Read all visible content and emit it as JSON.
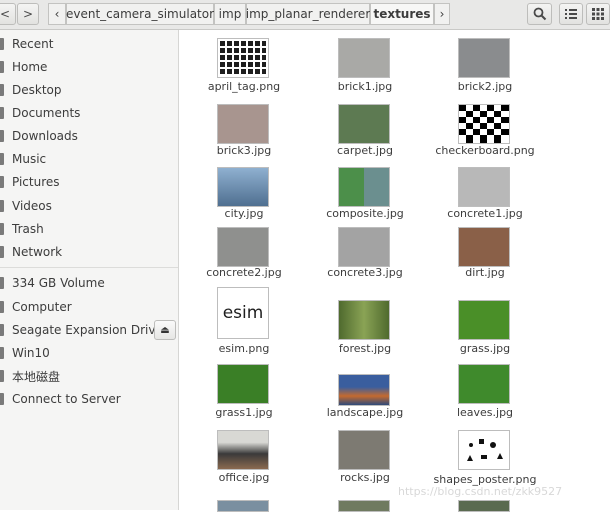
{
  "header": {
    "back_glyph": "<",
    "forward_glyph": ">",
    "crumb_left_glyph": "‹",
    "crumb_right_glyph": "›",
    "breadcrumbs": [
      "event_camera_simulator",
      "imp",
      "imp_planar_renderer",
      "textures"
    ],
    "search_icon": "search-icon",
    "list_icon": "list-view-icon",
    "grid_icon": "grid-view-icon"
  },
  "sidebar": {
    "items": [
      {
        "label": "Recent",
        "icon": "clock-icon"
      },
      {
        "label": "Home",
        "icon": "home-icon"
      },
      {
        "label": "Desktop",
        "icon": "desktop-icon"
      },
      {
        "label": "Documents",
        "icon": "documents-icon"
      },
      {
        "label": "Downloads",
        "icon": "downloads-icon"
      },
      {
        "label": "Music",
        "icon": "music-icon"
      },
      {
        "label": "Pictures",
        "icon": "pictures-icon"
      },
      {
        "label": "Videos",
        "icon": "videos-icon"
      },
      {
        "label": "Trash",
        "icon": "trash-icon"
      },
      {
        "label": "Network",
        "icon": "network-icon"
      },
      {
        "label": "334 GB Volume",
        "icon": "drive-icon"
      },
      {
        "label": "Computer",
        "icon": "computer-icon"
      },
      {
        "label": "Seagate Expansion Drive",
        "icon": "drive-icon"
      },
      {
        "label": "Win10",
        "icon": "drive-icon"
      },
      {
        "label": "本地磁盘",
        "icon": "drive-icon"
      },
      {
        "label": "Connect to Server",
        "icon": "server-icon"
      }
    ],
    "eject_glyph": "⏏"
  },
  "files": [
    {
      "name": "april_tag.png",
      "color": "#1e1e1e"
    },
    {
      "name": "brick1.jpg",
      "color": "#a9a9a6"
    },
    {
      "name": "brick2.jpg",
      "color": "#8a8c8e"
    },
    {
      "name": "brick3.jpg",
      "color": "#a8958f"
    },
    {
      "name": "carpet.jpg",
      "color": "#5d7a52"
    },
    {
      "name": "checkerboard.png",
      "color": "#000000"
    },
    {
      "name": "city.jpg",
      "color": "#6f8fb0"
    },
    {
      "name": "composite.jpg",
      "color": "#5c7f6a"
    },
    {
      "name": "concrete1.jpg",
      "color": "#b8b8b8"
    },
    {
      "name": "concrete2.jpg",
      "color": "#8f908e"
    },
    {
      "name": "concrete3.jpg",
      "color": "#a3a3a3"
    },
    {
      "name": "dirt.jpg",
      "color": "#8a6048"
    },
    {
      "name": "esim.png",
      "color": "#ffffff",
      "text": "esim"
    },
    {
      "name": "forest.jpg",
      "color": "#6b8a3e"
    },
    {
      "name": "grass.jpg",
      "color": "#4a8f28"
    },
    {
      "name": "grass1.jpg",
      "color": "#3a7f26"
    },
    {
      "name": "landscape.jpg",
      "color": "#3a5e9e"
    },
    {
      "name": "leaves.jpg",
      "color": "#3f8a2c"
    },
    {
      "name": "office.jpg",
      "color": "#5a5550"
    },
    {
      "name": "rocks.jpg",
      "color": "#7d7a72"
    },
    {
      "name": "shapes_poster.png",
      "color": "#ffffff"
    }
  ],
  "watermark": "https://blog.csdn.net/zkk9527"
}
